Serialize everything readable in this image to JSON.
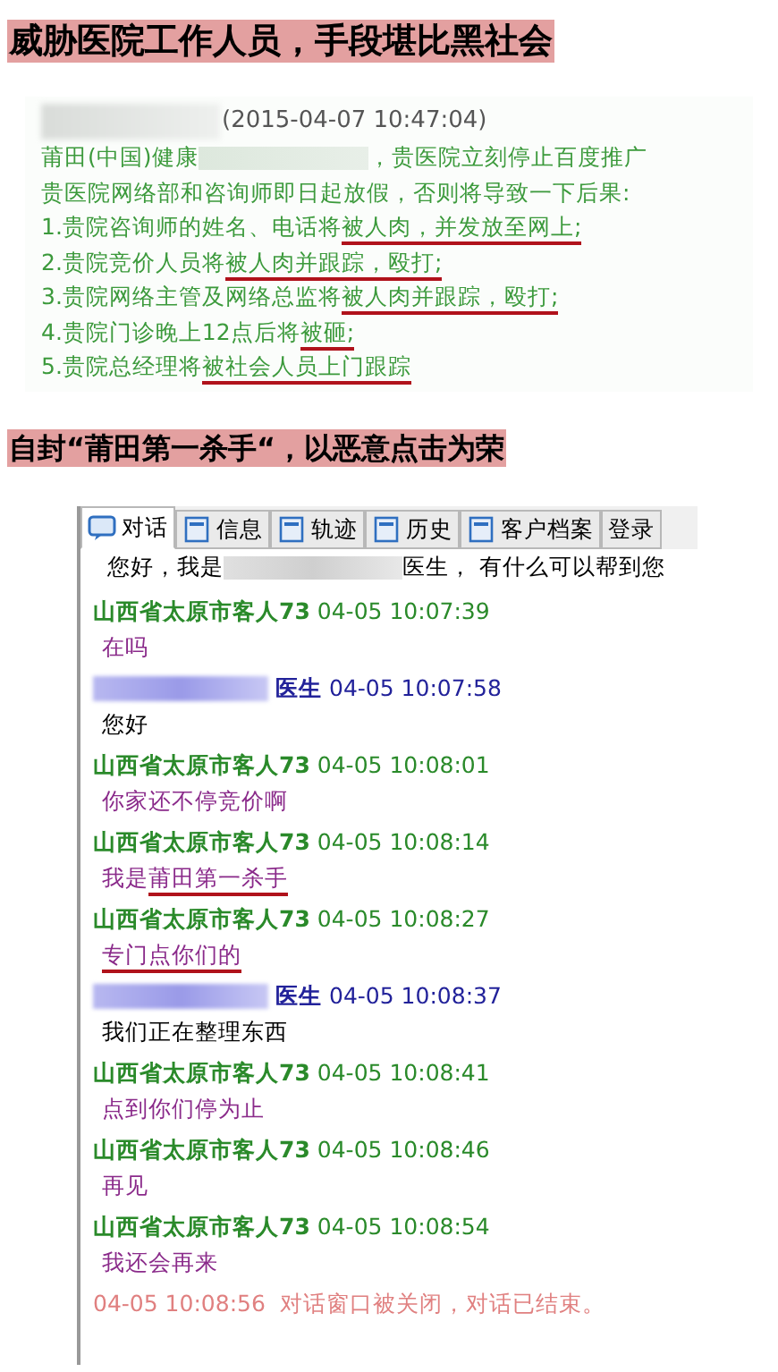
{
  "headline_1": "威胁医院工作人员，手段堪比黑社会",
  "threat_message": {
    "timestamp": "(2015-04-07 10:47:04)",
    "lines": [
      {
        "segments": [
          {
            "text": "莆田(中国)健康",
            "marked": false
          },
          {
            "kind": "redacted"
          },
          {
            "text": "，贵医院立刻停止百度推广",
            "marked": false
          }
        ]
      },
      {
        "segments": [
          {
            "text": "贵医院网络部和咨询师即日起放假，否则将导致一下后果:",
            "marked": false
          }
        ]
      },
      {
        "segments": [
          {
            "text": "1.贵院咨询师的姓名、电话将",
            "marked": false
          },
          {
            "text": "被人肉，并发放至网上;",
            "marked": true
          }
        ]
      },
      {
        "segments": [
          {
            "text": "2.贵院竞价人员将",
            "marked": false
          },
          {
            "text": "被人肉并跟踪，殴打;",
            "marked": true
          }
        ]
      },
      {
        "segments": [
          {
            "text": "3.贵院网络主管及网络总监将",
            "marked": false
          },
          {
            "text": "被人肉并跟踪，殴打;",
            "marked": true
          }
        ]
      },
      {
        "segments": [
          {
            "text": "4.贵院门诊晚上12点后将",
            "marked": false
          },
          {
            "text": "被砸;",
            "marked": true
          }
        ]
      },
      {
        "segments": [
          {
            "text": "5.贵院总经理将",
            "marked": false
          },
          {
            "text": "被社会人员上门跟踪",
            "marked": true
          }
        ]
      }
    ]
  },
  "headline_2": "自封“莆田第一杀手“，以恶意点击为荣",
  "chat_window": {
    "tabs": [
      {
        "label": "对话",
        "selected": true
      },
      {
        "label": "信息",
        "selected": false
      },
      {
        "label": "轨迹",
        "selected": false
      },
      {
        "label": "历史",
        "selected": false
      },
      {
        "label": "客户档案",
        "selected": false
      },
      {
        "label": "登录",
        "selected": false
      }
    ],
    "greeting": {
      "before": "您好，我是",
      "after": "医生， 有什么可以帮到您"
    },
    "messages": [
      {
        "kind": "guest",
        "sender": "山西省太原市客人73",
        "time": "04-05 10:07:39",
        "segments": [
          {
            "text": "在吗",
            "marked": false
          }
        ]
      },
      {
        "kind": "doctor",
        "sender": "医生",
        "time": "04-05 10:07:58",
        "segments": [
          {
            "text": "您好",
            "marked": false
          }
        ]
      },
      {
        "kind": "guest",
        "sender": "山西省太原市客人73",
        "time": "04-05 10:08:01",
        "segments": [
          {
            "text": "你家还不停竞价啊",
            "marked": false
          }
        ]
      },
      {
        "kind": "guest",
        "sender": "山西省太原市客人73",
        "time": "04-05 10:08:14",
        "segments": [
          {
            "text": "我是",
            "marked": false
          },
          {
            "text": "莆田第一杀手",
            "marked": true
          }
        ]
      },
      {
        "kind": "guest",
        "sender": "山西省太原市客人73",
        "time": "04-05 10:08:27",
        "segments": [
          {
            "text": "专门点你们的",
            "marked": true
          }
        ]
      },
      {
        "kind": "doctor",
        "sender": "医生",
        "time": "04-05 10:08:37",
        "segments": [
          {
            "text": "我们正在整理东西",
            "marked": false
          }
        ]
      },
      {
        "kind": "guest",
        "sender": "山西省太原市客人73",
        "time": "04-05 10:08:41",
        "segments": [
          {
            "text": "点到你们停为止",
            "marked": false
          }
        ]
      },
      {
        "kind": "guest",
        "sender": "山西省太原市客人73",
        "time": "04-05 10:08:46",
        "segments": [
          {
            "text": "再见",
            "marked": false
          }
        ]
      },
      {
        "kind": "guest",
        "sender": "山西省太原市客人73",
        "time": "04-05 10:08:54",
        "segments": [
          {
            "text": "我还会再来",
            "marked": false
          }
        ]
      },
      {
        "kind": "system",
        "time": "04-05 10:08:56",
        "text": "对话窗口被关闭，对话已结束。"
      }
    ]
  }
}
